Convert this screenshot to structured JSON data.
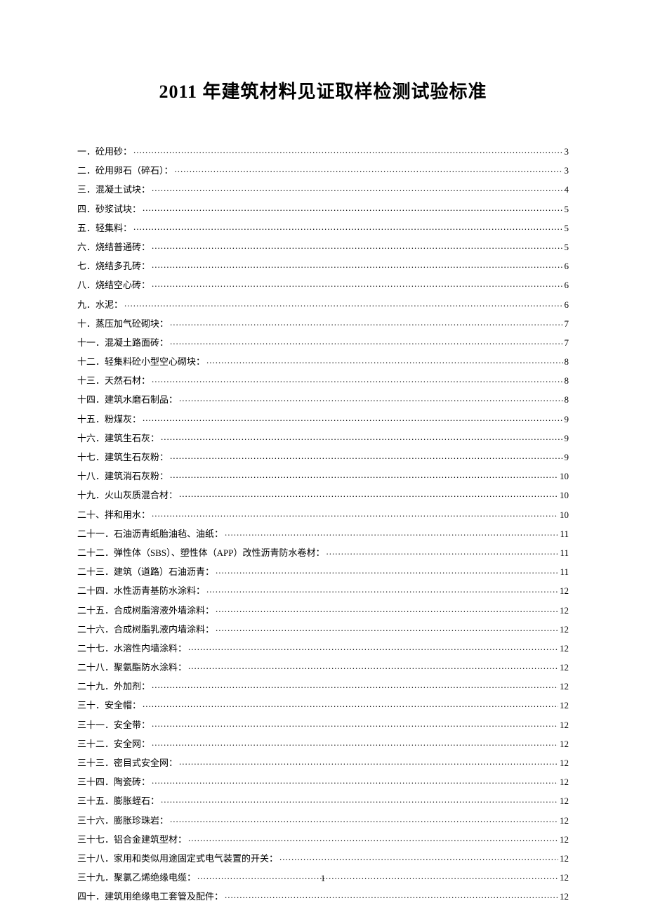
{
  "title": "2011 年建筑材料见证取样检测试验标准",
  "pageNumber": "1",
  "toc": [
    {
      "label": "一．砼用砂：",
      "page": "3"
    },
    {
      "label": "二．砼用卵石（碎石）：",
      "page": "3"
    },
    {
      "label": "三．混凝土试块：",
      "page": "4"
    },
    {
      "label": "四．砂浆试块：",
      "page": "5"
    },
    {
      "label": "五．轻集料：",
      "page": "5"
    },
    {
      "label": "六．烧结普通砖：",
      "page": "5"
    },
    {
      "label": "七．烧结多孔砖：",
      "page": "6"
    },
    {
      "label": "八．烧结空心砖：",
      "page": "6"
    },
    {
      "label": "九．水泥：",
      "page": "6"
    },
    {
      "label": "十．蒸压加气砼砌块：",
      "page": "7"
    },
    {
      "label": "十一．混凝土路面砖：",
      "page": "7"
    },
    {
      "label": "十二．轻集料砼小型空心砌块：",
      "page": "8"
    },
    {
      "label": "十三．天然石材：",
      "page": "8"
    },
    {
      "label": "十四．建筑水磨石制品：",
      "page": "8"
    },
    {
      "label": "十五．粉煤灰：",
      "page": "9"
    },
    {
      "label": "十六．建筑生石灰：",
      "page": "9"
    },
    {
      "label": "十七．建筑生石灰粉：",
      "page": "9"
    },
    {
      "label": "十八．建筑消石灰粉：",
      "page": "10"
    },
    {
      "label": "十九．火山灰质混合材：",
      "page": "10"
    },
    {
      "label": "二十、拌和用水：",
      "page": "10"
    },
    {
      "label": "二十一．石油沥青纸胎油毡、油纸：",
      "page": "11"
    },
    {
      "label": "二十二．弹性体（SBS）、塑性体（APP）改性沥青防水卷材：",
      "page": "11"
    },
    {
      "label": "二十三．建筑（道路）石油沥青：",
      "page": "11"
    },
    {
      "label": "二十四．水性沥青基防水涂料：",
      "page": "12"
    },
    {
      "label": "二十五．合成树脂溶液外墙涂料：",
      "page": "12"
    },
    {
      "label": "二十六．合成树脂乳液内墙涂料：",
      "page": "12"
    },
    {
      "label": "二十七．水溶性内墙涂料：",
      "page": "12"
    },
    {
      "label": "二十八．聚氨酯防水涂料：",
      "page": "12"
    },
    {
      "label": "二十九．外加剂：",
      "page": "12"
    },
    {
      "label": "三十．安全帽：",
      "page": "12"
    },
    {
      "label": "三十一．安全带：",
      "page": "12"
    },
    {
      "label": "三十二．安全网：",
      "page": "12"
    },
    {
      "label": "三十三．密目式安全网：",
      "page": "12"
    },
    {
      "label": "三十四．陶瓷砖：",
      "page": "12"
    },
    {
      "label": "三十五．膨胀蛭石：",
      "page": "12"
    },
    {
      "label": "三十六．膨胀珍珠岩：",
      "page": "12"
    },
    {
      "label": "三十七．铝合金建筑型材：",
      "page": "12"
    },
    {
      "label": "三十八．家用和类似用途固定式电气装置的开关：",
      "page": "12"
    },
    {
      "label": "三十九．聚氯乙烯绝缘电缆：",
      "page": "12"
    },
    {
      "label": "四十．建筑用绝缘电工套管及配件：",
      "page": "12"
    }
  ]
}
